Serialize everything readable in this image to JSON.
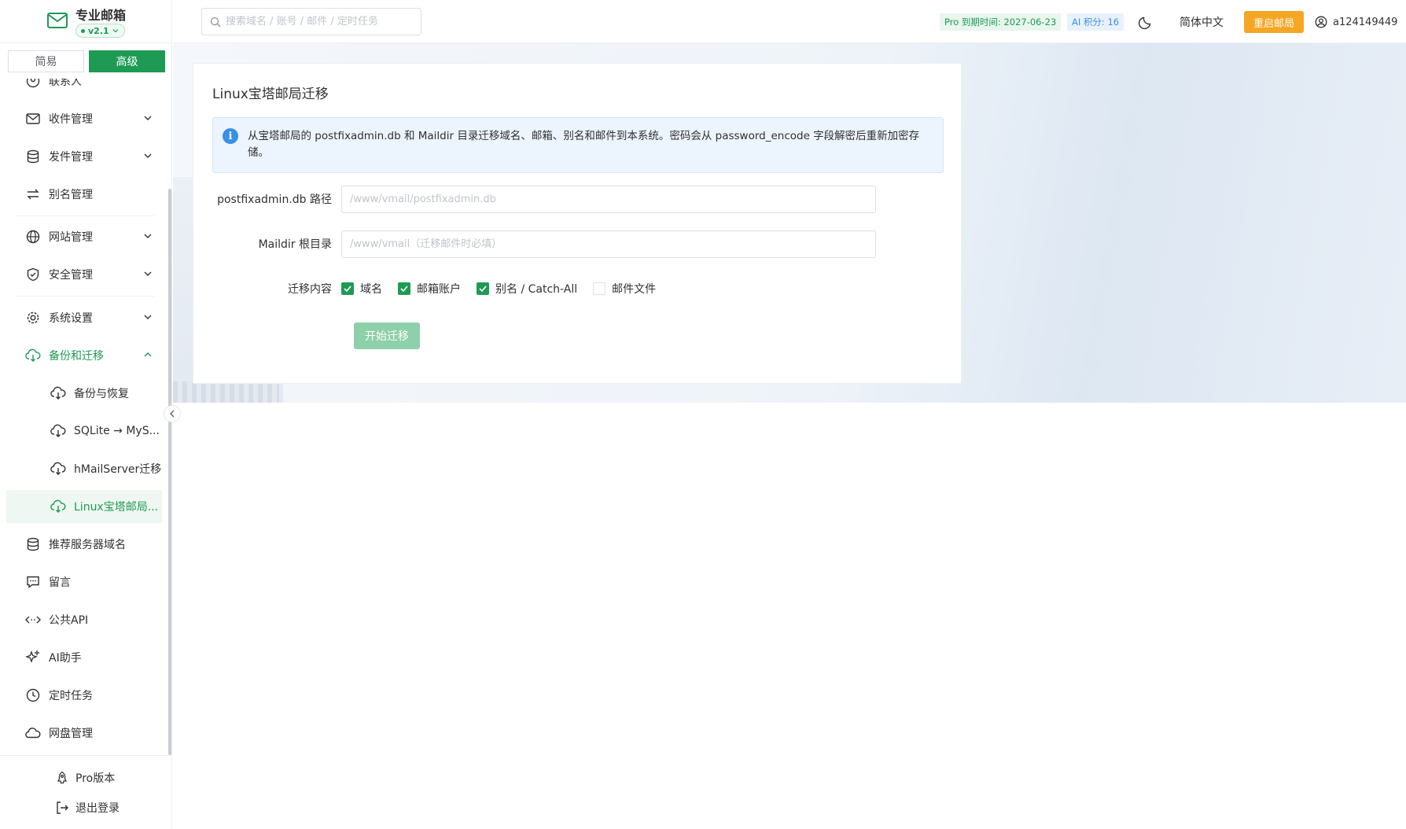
{
  "brand": {
    "name": "专业邮箱",
    "version": "v2.1"
  },
  "mode": {
    "simple": "简易",
    "advanced": "高级"
  },
  "sidebar": {
    "items": [
      {
        "label": "联系人"
      },
      {
        "label": "收件管理"
      },
      {
        "label": "发件管理"
      },
      {
        "label": "别名管理"
      },
      {
        "label": "网站管理"
      },
      {
        "label": "安全管理"
      },
      {
        "label": "系统设置"
      },
      {
        "label": "备份和迁移"
      },
      {
        "label": "备份与恢复"
      },
      {
        "label": "SQLite → MyS..."
      },
      {
        "label": "hMailServer迁移"
      },
      {
        "label": "Linux宝塔邮局..."
      },
      {
        "label": "推荐服务器域名"
      },
      {
        "label": "留言"
      },
      {
        "label": "公共API"
      },
      {
        "label": "AI助手"
      },
      {
        "label": "定时任务"
      },
      {
        "label": "网盘管理"
      }
    ],
    "footer": {
      "pro": "Pro版本",
      "logout": "退出登录"
    }
  },
  "header": {
    "search_placeholder": "搜索域名 / 账号 / 邮件 / 定时任务",
    "pro_tag": "Pro 到期时间: 2027-06-23",
    "ai_tag": "AI 积分: 16",
    "language": "简体中文",
    "restart": "重启邮局",
    "username": "a124149449"
  },
  "page": {
    "title": "Linux宝塔邮局迁移",
    "alert": "从宝塔邮局的 postfixadmin.db 和 Maildir 目录迁移域名、邮箱、别名和邮件到本系统。密码会从 password_encode 字段解密后重新加密存储。",
    "fields": {
      "db_label": "postfixadmin.db 路径",
      "db_placeholder": "/www/vmail/postfixadmin.db",
      "maildir_label": "Maildir 根目录",
      "maildir_placeholder": "/www/vmail（迁移邮件时必填）",
      "content_label": "迁移内容"
    },
    "options": [
      {
        "label": "域名",
        "checked": true
      },
      {
        "label": "邮箱账户",
        "checked": true
      },
      {
        "label": "别名 / Catch-All",
        "checked": true
      },
      {
        "label": "邮件文件",
        "checked": false
      }
    ],
    "start_button": "开始迁移"
  },
  "colors": {
    "accent": "#1e9a55",
    "warning": "#f5a623",
    "info": "#3a8ee6"
  }
}
